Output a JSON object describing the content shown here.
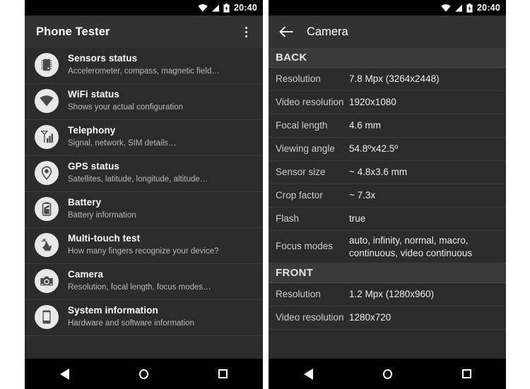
{
  "statusbar": {
    "time": "20:40",
    "icons": [
      "wifi-icon",
      "signal-icon",
      "battery-charging-icon"
    ]
  },
  "left_screen": {
    "app_title": "Phone Tester",
    "overflow_label": "More options",
    "items": [
      {
        "icon": "chip-icon",
        "title": "Sensors status",
        "subtitle": "Accelerometer, compass, magnetic field…"
      },
      {
        "icon": "wifi-icon",
        "title": "WiFi status",
        "subtitle": "Shows your actual configuration"
      },
      {
        "icon": "antenna-bars-icon",
        "title": "Telephony",
        "subtitle": "Signal, network, SIM details…"
      },
      {
        "icon": "map-pin-icon",
        "title": "GPS status",
        "subtitle": "Satellites, latitude, longitude, altitude…"
      },
      {
        "icon": "battery-icon",
        "title": "Battery",
        "subtitle": "Battery information"
      },
      {
        "icon": "hand-touch-icon",
        "title": "Multi-touch test",
        "subtitle": "How many fingers recognize your device?"
      },
      {
        "icon": "camera-icon",
        "title": "Camera",
        "subtitle": "Resolution, focal length, focus modes…"
      },
      {
        "icon": "phone-icon",
        "title": "System information",
        "subtitle": "Hardware and software information"
      }
    ]
  },
  "right_screen": {
    "screen_title": "Camera",
    "back_label": "Navigate up",
    "sections": [
      {
        "heading": "BACK",
        "rows": [
          {
            "key": "Resolution",
            "value": "7.8 Mpx (3264x2448)"
          },
          {
            "key": "Video resolution",
            "value": "1920x1080"
          },
          {
            "key": "Focal length",
            "value": "4.6 mm"
          },
          {
            "key": "Viewing angle",
            "value": "54.8ºx42.5º"
          },
          {
            "key": "Sensor size",
            "value": "~ 4.8x3.6 mm"
          },
          {
            "key": "Crop factor",
            "value": "~ 7.3x"
          },
          {
            "key": "Flash",
            "value": "true"
          },
          {
            "key": "Focus modes",
            "value": "auto, infinity, normal, macro, continuous, video continuous"
          }
        ]
      },
      {
        "heading": "FRONT",
        "rows": [
          {
            "key": "Resolution",
            "value": "1.2 Mpx (1280x960)"
          },
          {
            "key": "Video resolution",
            "value": "1280x720"
          }
        ]
      }
    ]
  },
  "navbar": {
    "back_label": "Back",
    "home_label": "Home",
    "recents_label": "Recents"
  },
  "colors": {
    "window_bg": "#2b2b2b",
    "actionbar_bg": "#323232",
    "section_bg": "#3a3a3a",
    "statusbar_bg": "#000000",
    "icon_circle": "#e8e8e8",
    "primary_text": "#ffffff",
    "secondary_text": "#b9b9b9"
  }
}
